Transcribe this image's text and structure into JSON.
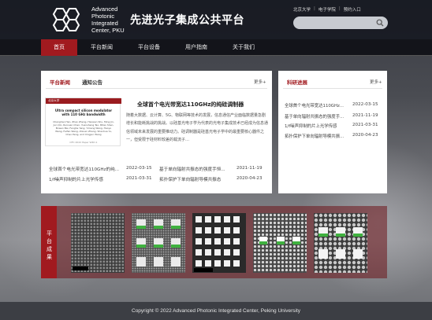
{
  "header": {
    "logo_lines": [
      "Advanced",
      "Photonic",
      "Integrated",
      "Center, PKU"
    ],
    "site_title": "先进光子集成公共平台",
    "top_links": [
      "北京大学",
      "电子学院",
      "预约入口"
    ],
    "search_placeholder": ""
  },
  "nav": {
    "items": [
      "首页",
      "平台新闻",
      "平台设备",
      "用户指南",
      "关于我们"
    ],
    "active_index": 0
  },
  "news": {
    "tabs": [
      "平台新闻",
      "通知公告"
    ],
    "more": "更多+",
    "thumb": {
      "header": "北京大学",
      "title": "Ultra compact silicon modulator with 110 GHz bandwidth",
      "authors": "Changhao Han, Zhao Zheng, Haowen Shu, Ming Jin, Jun Qin, Ruixuan Chen, Yuansheng Tao, Bitao Shen, Bowen Bai, Fenghe Yang, Yimeng Wang, Haoyu Wang, Feifan Wang, Zixuan Zhang, Shaohua Yu, Chao Peng, and Xingjun Wang",
      "footer": "OFC 2022 Paper W4D.1"
    },
    "featured_title": "全球首个电光带宽达110GHz的纯硅调制器",
    "featured_body": "随着大数据、云计算、5G、物联网等技术的发展，信息通信产业面临数据量急剧增长和能耗挑战的挑战。以硅基光电子学为代表的光电子集成技术已经成为信息通信领域未来发展的重要推动力。硅调制器是硅基光电子学中的最重要核心器件之一，但受限于硅材料较差的载流子…",
    "items": [
      {
        "title": "全球首个电光带宽达110GHz的纯...",
        "date": "2022-03-15"
      },
      {
        "title": "基于单向辐射共振态的强度手恒...",
        "date": "2021-11-19"
      },
      {
        "title": "1/f噪声抑制的片上光学传感",
        "date": "2021-03-31"
      },
      {
        "title": "拓扑保护下单向辐射导模共振态",
        "date": "2020-04-23"
      }
    ]
  },
  "research": {
    "tab": "科研进展",
    "more": "更多+",
    "items": [
      {
        "title": "全球首个电光带宽达110GHz...",
        "date": "2022-03-15"
      },
      {
        "title": "基于单向辐射共振态的强度手...",
        "date": "2021-11-19"
      },
      {
        "title": "1/f噪声抑制的片上光学传感",
        "date": "2021-03-31"
      },
      {
        "title": "拓扑保护下单向辐射导模共振...",
        "date": "2020-04-23"
      }
    ]
  },
  "achievements": {
    "label": "平台成果"
  },
  "footer": {
    "copyright": "Copyright ©   2022 Advanced Photonic Integrated Center, Peking University"
  },
  "colors": {
    "accent": "#a11a1f",
    "header_bg": "#14161e",
    "footer_bg": "#3c3e44"
  }
}
